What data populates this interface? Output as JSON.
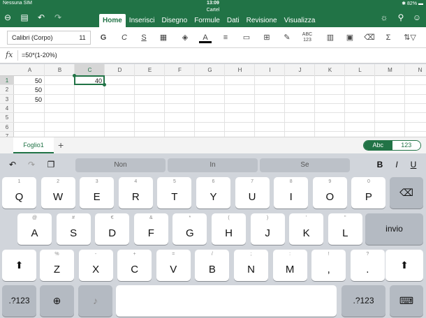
{
  "status": {
    "carrier": "Nessuna SIM",
    "time": "13:09",
    "battery": "82%"
  },
  "document": {
    "title": "Cartel"
  },
  "tabs": [
    {
      "label": "Home",
      "active": true
    },
    {
      "label": "Inserisci"
    },
    {
      "label": "Disegno"
    },
    {
      "label": "Formule"
    },
    {
      "label": "Dati"
    },
    {
      "label": "Revisione"
    },
    {
      "label": "Visualizza"
    }
  ],
  "ribbon": {
    "font_name": "Calibri (Corpo)",
    "font_size": "11",
    "bold": "G",
    "italic": "C",
    "underline": "S",
    "font_color": "A",
    "spell": "ABC\n123",
    "sum": "Σ"
  },
  "formula_bar": {
    "fx": "fx",
    "formula": "=50*(1-20%)"
  },
  "grid": {
    "columns": [
      "A",
      "B",
      "C",
      "D",
      "E",
      "F",
      "G",
      "H",
      "I",
      "J",
      "K",
      "L",
      "M",
      "N"
    ],
    "rows": [
      "1",
      "2",
      "3",
      "4",
      "5",
      "6",
      "7"
    ],
    "selected_column": "C",
    "selected_row": "1",
    "cells": {
      "A1": "50",
      "A2": "50",
      "A3": "50",
      "C1": "40"
    }
  },
  "sheets": {
    "tab": "Foglio1",
    "add": "+",
    "toggle_abc": "Abc",
    "toggle_123": "123"
  },
  "keyboard": {
    "suggestions": [
      "Non",
      "In",
      "Se"
    ],
    "format": {
      "bold": "B",
      "italic": "I",
      "underline": "U"
    },
    "row1": [
      {
        "num": "1",
        "key": "Q"
      },
      {
        "num": "2",
        "key": "W"
      },
      {
        "num": "3",
        "key": "E"
      },
      {
        "num": "4",
        "key": "R"
      },
      {
        "num": "5",
        "key": "T"
      },
      {
        "num": "6",
        "key": "Y"
      },
      {
        "num": "7",
        "key": "U"
      },
      {
        "num": "8",
        "key": "I"
      },
      {
        "num": "9",
        "key": "O"
      },
      {
        "num": "0",
        "key": "P"
      }
    ],
    "row2": [
      {
        "num": "@",
        "key": "A"
      },
      {
        "num": "#",
        "key": "S"
      },
      {
        "num": "€",
        "key": "D"
      },
      {
        "num": "&",
        "key": "F"
      },
      {
        "num": "*",
        "key": "G"
      },
      {
        "num": "(",
        "key": "H"
      },
      {
        "num": ")",
        "key": "J"
      },
      {
        "num": "'",
        "key": "K"
      },
      {
        "num": "\"",
        "key": "L"
      }
    ],
    "row3": [
      {
        "num": "%",
        "key": "Z"
      },
      {
        "num": "-",
        "key": "X"
      },
      {
        "num": "+",
        "key": "C"
      },
      {
        "num": "=",
        "key": "V"
      },
      {
        "num": "/",
        "key": "B"
      },
      {
        "num": ";",
        "key": "N"
      },
      {
        "num": ":",
        "key": "M"
      },
      {
        "num": "!",
        "key": ","
      },
      {
        "num": "?",
        "key": "."
      }
    ],
    "return_label": "invio",
    "numbers_label": ".?123"
  }
}
